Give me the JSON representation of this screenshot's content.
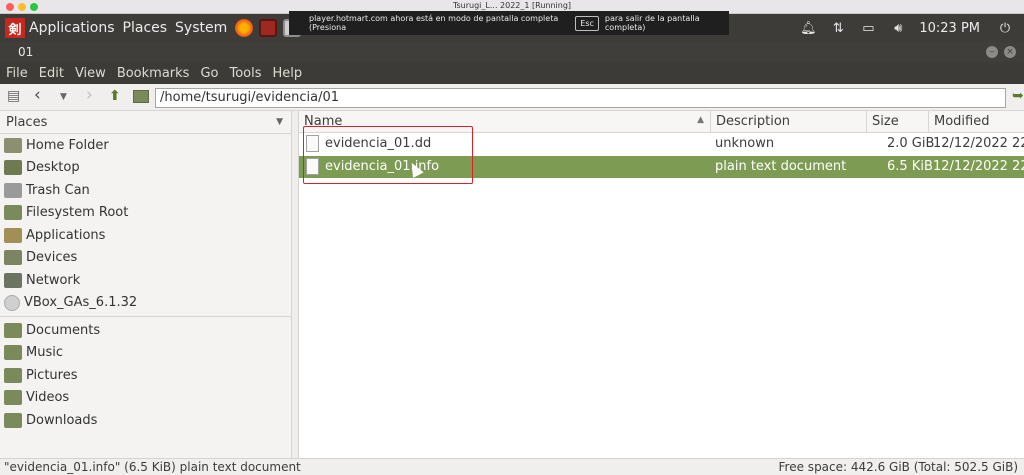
{
  "host_window": {
    "title": "Tsurugi_L... 2022_1 [Running]"
  },
  "panel": {
    "menus": [
      "Applications",
      "Places",
      "System"
    ],
    "clock": "10:23 PM"
  },
  "fullscreen_notice": {
    "before": "player.hotmart.com ahora está en modo de pantalla completa (Presiona",
    "key": "Esc",
    "after": "para salir de la pantalla completa)"
  },
  "window": {
    "title": "01"
  },
  "menubar": [
    "File",
    "Edit",
    "View",
    "Bookmarks",
    "Go",
    "Tools",
    "Help"
  ],
  "location": {
    "path": "/home/tsurugi/evidencia/01"
  },
  "sidebar": {
    "header": "Places",
    "group1": [
      {
        "label": "Home Folder",
        "icon": "home-folder-icon",
        "color": "#8c8f70"
      },
      {
        "label": "Desktop",
        "icon": "desktop-icon",
        "color": "#6f7a50"
      },
      {
        "label": "Trash Can",
        "icon": "trash-icon",
        "color": "#9a9a9a"
      },
      {
        "label": "Filesystem Root",
        "icon": "filesystem-icon",
        "color": "#7a8a5a"
      },
      {
        "label": "Applications",
        "icon": "applications-icon",
        "color": "#a28f55"
      },
      {
        "label": "Devices",
        "icon": "devices-icon",
        "color": "#7d8461"
      },
      {
        "label": "Network",
        "icon": "network-icon",
        "color": "#6c7461"
      },
      {
        "label": "VBox_GAs_6.1.32",
        "icon": "disc-icon",
        "color": "#d0d0d0"
      }
    ],
    "group2": [
      {
        "label": "Documents",
        "icon": "documents-icon",
        "color": "#7a8a5a"
      },
      {
        "label": "Music",
        "icon": "music-icon",
        "color": "#7a8a5a"
      },
      {
        "label": "Pictures",
        "icon": "pictures-icon",
        "color": "#7a8a5a"
      },
      {
        "label": "Videos",
        "icon": "videos-icon",
        "color": "#7a8a5a"
      },
      {
        "label": "Downloads",
        "icon": "downloads-icon",
        "color": "#7a8a5a"
      }
    ]
  },
  "columns": {
    "name": "Name",
    "description": "Description",
    "size": "Size",
    "modified": "Modified"
  },
  "files": [
    {
      "name": "evidencia_01.dd",
      "description": "unknown",
      "size": "2.0 GiB",
      "modified": "12/12/2022 22:2",
      "selected": false
    },
    {
      "name": "evidencia_01.info",
      "description": "plain text document",
      "size": "6.5 KiB",
      "modified": "12/12/2022 22:2",
      "selected": true
    }
  ],
  "status": {
    "left": "\"evidencia_01.info\" (6.5 KiB) plain text document",
    "right": "Free space: 442.6 GiB (Total: 502.5 GiB)"
  },
  "colors": {
    "selection": "#7d9b52",
    "panel": "#3d3c38",
    "highlight_box": "#d6232a"
  }
}
